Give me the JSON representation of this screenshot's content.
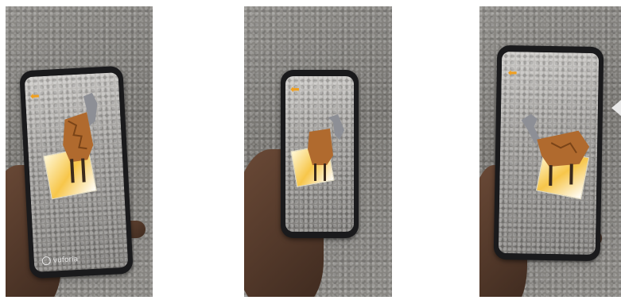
{
  "photos": [
    {
      "id": "left",
      "watermark": "vuforia"
    },
    {
      "id": "middle",
      "watermark": ""
    },
    {
      "id": "right",
      "watermark": ""
    }
  ],
  "icons": {
    "back": "arrow-left-icon",
    "brand": "vuforia-logo-icon"
  },
  "colors": {
    "ar_arrow": "#f0a020",
    "giraffe_body": "#b06a2e",
    "giraffe_head": "#8d8f96",
    "marker": "#f7c64a"
  }
}
